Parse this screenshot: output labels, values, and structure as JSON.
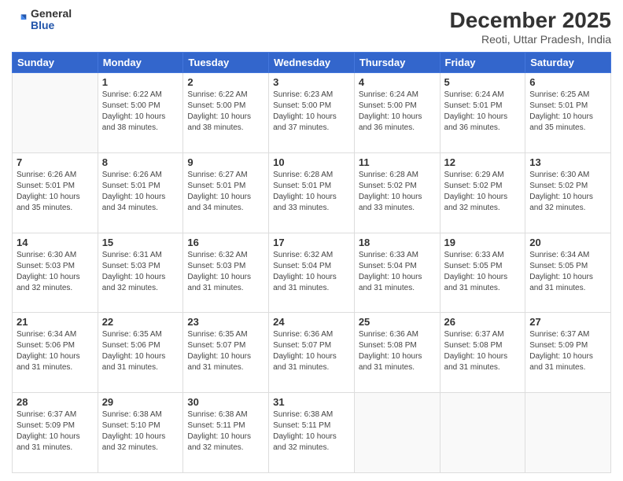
{
  "header": {
    "logo_general": "General",
    "logo_blue": "Blue",
    "month_title": "December 2025",
    "subtitle": "Reoti, Uttar Pradesh, India"
  },
  "weekdays": [
    "Sunday",
    "Monday",
    "Tuesday",
    "Wednesday",
    "Thursday",
    "Friday",
    "Saturday"
  ],
  "weeks": [
    [
      {
        "day": "",
        "info": ""
      },
      {
        "day": "1",
        "info": "Sunrise: 6:22 AM\nSunset: 5:00 PM\nDaylight: 10 hours\nand 38 minutes."
      },
      {
        "day": "2",
        "info": "Sunrise: 6:22 AM\nSunset: 5:00 PM\nDaylight: 10 hours\nand 38 minutes."
      },
      {
        "day": "3",
        "info": "Sunrise: 6:23 AM\nSunset: 5:00 PM\nDaylight: 10 hours\nand 37 minutes."
      },
      {
        "day": "4",
        "info": "Sunrise: 6:24 AM\nSunset: 5:00 PM\nDaylight: 10 hours\nand 36 minutes."
      },
      {
        "day": "5",
        "info": "Sunrise: 6:24 AM\nSunset: 5:01 PM\nDaylight: 10 hours\nand 36 minutes."
      },
      {
        "day": "6",
        "info": "Sunrise: 6:25 AM\nSunset: 5:01 PM\nDaylight: 10 hours\nand 35 minutes."
      }
    ],
    [
      {
        "day": "7",
        "info": "Sunrise: 6:26 AM\nSunset: 5:01 PM\nDaylight: 10 hours\nand 35 minutes."
      },
      {
        "day": "8",
        "info": "Sunrise: 6:26 AM\nSunset: 5:01 PM\nDaylight: 10 hours\nand 34 minutes."
      },
      {
        "day": "9",
        "info": "Sunrise: 6:27 AM\nSunset: 5:01 PM\nDaylight: 10 hours\nand 34 minutes."
      },
      {
        "day": "10",
        "info": "Sunrise: 6:28 AM\nSunset: 5:01 PM\nDaylight: 10 hours\nand 33 minutes."
      },
      {
        "day": "11",
        "info": "Sunrise: 6:28 AM\nSunset: 5:02 PM\nDaylight: 10 hours\nand 33 minutes."
      },
      {
        "day": "12",
        "info": "Sunrise: 6:29 AM\nSunset: 5:02 PM\nDaylight: 10 hours\nand 32 minutes."
      },
      {
        "day": "13",
        "info": "Sunrise: 6:30 AM\nSunset: 5:02 PM\nDaylight: 10 hours\nand 32 minutes."
      }
    ],
    [
      {
        "day": "14",
        "info": "Sunrise: 6:30 AM\nSunset: 5:03 PM\nDaylight: 10 hours\nand 32 minutes."
      },
      {
        "day": "15",
        "info": "Sunrise: 6:31 AM\nSunset: 5:03 PM\nDaylight: 10 hours\nand 32 minutes."
      },
      {
        "day": "16",
        "info": "Sunrise: 6:32 AM\nSunset: 5:03 PM\nDaylight: 10 hours\nand 31 minutes."
      },
      {
        "day": "17",
        "info": "Sunrise: 6:32 AM\nSunset: 5:04 PM\nDaylight: 10 hours\nand 31 minutes."
      },
      {
        "day": "18",
        "info": "Sunrise: 6:33 AM\nSunset: 5:04 PM\nDaylight: 10 hours\nand 31 minutes."
      },
      {
        "day": "19",
        "info": "Sunrise: 6:33 AM\nSunset: 5:05 PM\nDaylight: 10 hours\nand 31 minutes."
      },
      {
        "day": "20",
        "info": "Sunrise: 6:34 AM\nSunset: 5:05 PM\nDaylight: 10 hours\nand 31 minutes."
      }
    ],
    [
      {
        "day": "21",
        "info": "Sunrise: 6:34 AM\nSunset: 5:06 PM\nDaylight: 10 hours\nand 31 minutes."
      },
      {
        "day": "22",
        "info": "Sunrise: 6:35 AM\nSunset: 5:06 PM\nDaylight: 10 hours\nand 31 minutes."
      },
      {
        "day": "23",
        "info": "Sunrise: 6:35 AM\nSunset: 5:07 PM\nDaylight: 10 hours\nand 31 minutes."
      },
      {
        "day": "24",
        "info": "Sunrise: 6:36 AM\nSunset: 5:07 PM\nDaylight: 10 hours\nand 31 minutes."
      },
      {
        "day": "25",
        "info": "Sunrise: 6:36 AM\nSunset: 5:08 PM\nDaylight: 10 hours\nand 31 minutes."
      },
      {
        "day": "26",
        "info": "Sunrise: 6:37 AM\nSunset: 5:08 PM\nDaylight: 10 hours\nand 31 minutes."
      },
      {
        "day": "27",
        "info": "Sunrise: 6:37 AM\nSunset: 5:09 PM\nDaylight: 10 hours\nand 31 minutes."
      }
    ],
    [
      {
        "day": "28",
        "info": "Sunrise: 6:37 AM\nSunset: 5:09 PM\nDaylight: 10 hours\nand 31 minutes."
      },
      {
        "day": "29",
        "info": "Sunrise: 6:38 AM\nSunset: 5:10 PM\nDaylight: 10 hours\nand 32 minutes."
      },
      {
        "day": "30",
        "info": "Sunrise: 6:38 AM\nSunset: 5:11 PM\nDaylight: 10 hours\nand 32 minutes."
      },
      {
        "day": "31",
        "info": "Sunrise: 6:38 AM\nSunset: 5:11 PM\nDaylight: 10 hours\nand 32 minutes."
      },
      {
        "day": "",
        "info": ""
      },
      {
        "day": "",
        "info": ""
      },
      {
        "day": "",
        "info": ""
      }
    ]
  ]
}
